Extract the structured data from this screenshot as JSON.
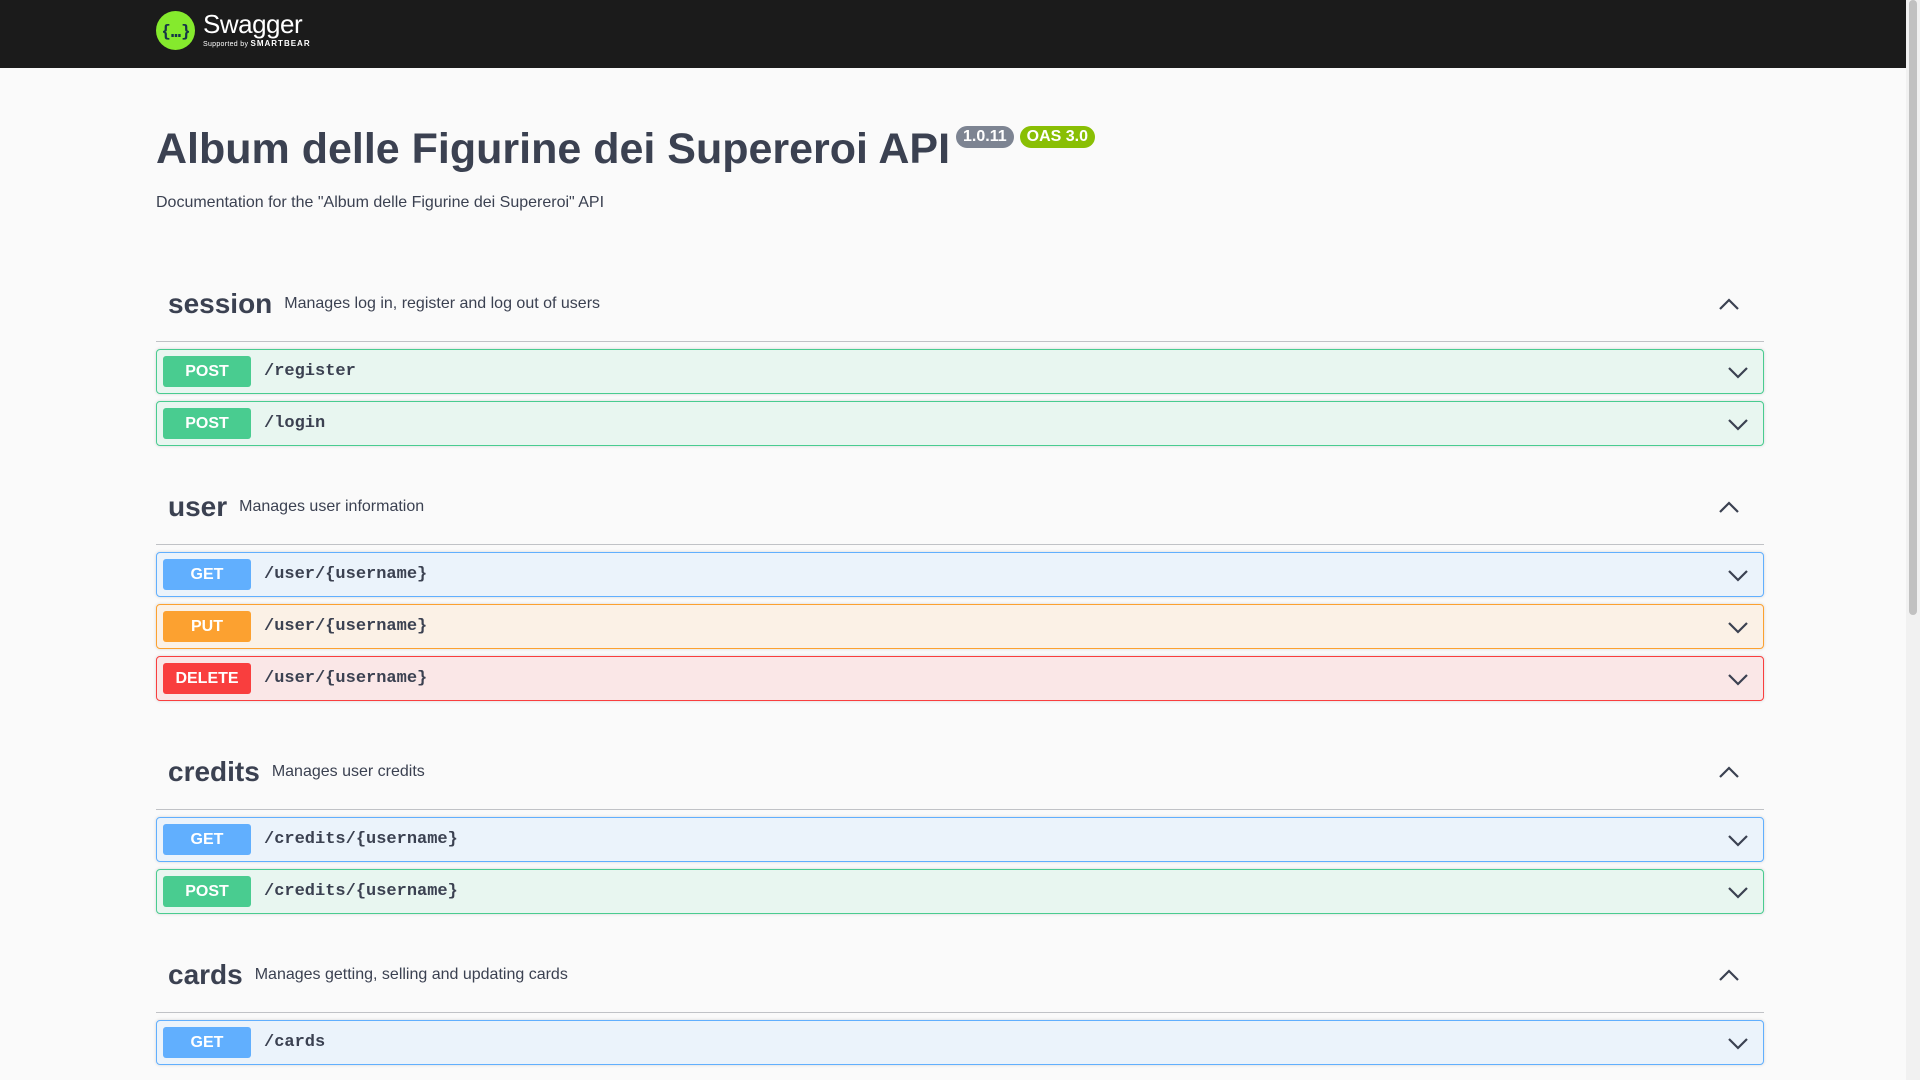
{
  "topbar": {
    "logo_name": "Swagger",
    "logo_sub_prefix": "Supported by",
    "logo_sub_brand": "SMARTBEAR",
    "logo_icon": "swagger-braces-icon"
  },
  "info": {
    "title": "Album delle Figurine dei Supereroi API",
    "version": "1.0.11",
    "oas": "OAS 3.0",
    "description": "Documentation for the \"Album delle Figurine dei Supereroi\" API"
  },
  "colors": {
    "post": "#49cc90",
    "get": "#61affe",
    "put": "#fca130",
    "delete": "#f93e3e",
    "topbar": "#1b1b1b",
    "logo": "#85ea2d"
  },
  "tags": [
    {
      "name": "session",
      "description": "Manages log in, register and log out of users",
      "operations": [
        {
          "method": "POST",
          "path": "/register"
        },
        {
          "method": "POST",
          "path": "/login"
        }
      ]
    },
    {
      "name": "user",
      "description": "Manages user information",
      "operations": [
        {
          "method": "GET",
          "path": "/user/{username}"
        },
        {
          "method": "PUT",
          "path": "/user/{username}"
        },
        {
          "method": "DELETE",
          "path": "/user/{username}"
        }
      ]
    },
    {
      "name": "credits",
      "description": "Manages user credits",
      "operations": [
        {
          "method": "GET",
          "path": "/credits/{username}"
        },
        {
          "method": "POST",
          "path": "/credits/{username}"
        }
      ]
    },
    {
      "name": "cards",
      "description": "Manages getting, selling and updating cards",
      "operations": [
        {
          "method": "GET",
          "path": "/cards"
        }
      ]
    }
  ]
}
